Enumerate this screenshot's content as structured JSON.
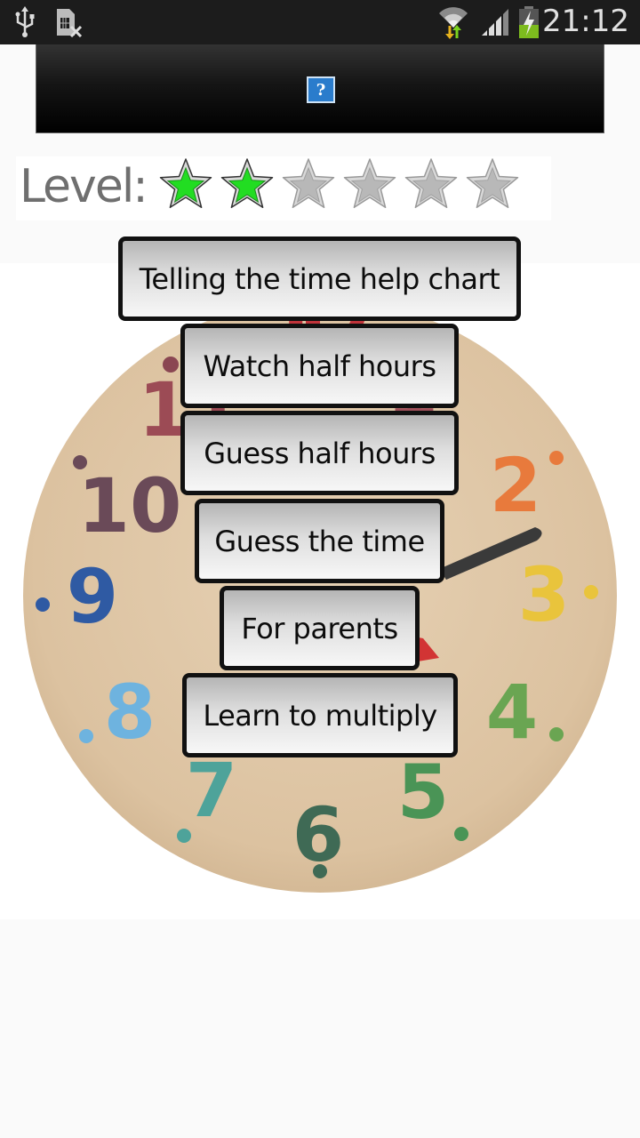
{
  "status_bar": {
    "time": "21:12",
    "left_icons": [
      "usb-icon",
      "no-sim-icon"
    ],
    "right_icons": [
      "wifi-data-icon",
      "signal-icon",
      "battery-charging-icon"
    ]
  },
  "ad_banner": {
    "icon": "broken-image-icon",
    "icon_glyph": "?"
  },
  "level": {
    "label": "Level:",
    "stars_total": 6,
    "stars_earned": 2,
    "earned_color": "#22dd22",
    "unearned_color": "#b8b8b8"
  },
  "menu": {
    "buttons": [
      {
        "label": "Telling the time help chart"
      },
      {
        "label": "Watch half hours"
      },
      {
        "label": "Guess half hours"
      },
      {
        "label": "Guess the time"
      },
      {
        "label": "For parents"
      },
      {
        "label": "Learn to multiply"
      }
    ]
  },
  "clock": {
    "numbers": [
      "1",
      "2",
      "3",
      "4",
      "5",
      "6",
      "7",
      "8",
      "9",
      "10",
      "11",
      "12"
    ],
    "colors": {
      "face": "#dcc3a2",
      "n10": "#6a4a58",
      "n11": "#9c4b55",
      "n2": "#e87a3c",
      "n3": "#e9c43c",
      "n4": "#6aa552",
      "n5": "#4a9456",
      "n6": "#3f6a55",
      "n7": "#4ea39a",
      "n8": "#6eb3df",
      "n9": "#2f5aa3",
      "minute_hand": "#3a3a3a",
      "hour_hand": "#d23434"
    }
  }
}
